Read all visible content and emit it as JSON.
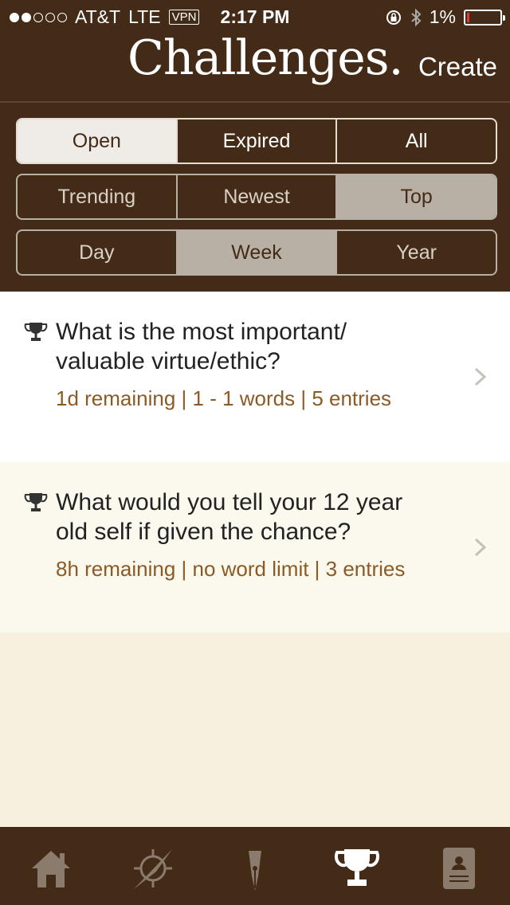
{
  "status_bar": {
    "carrier": "AT&T",
    "network": "LTE",
    "vpn": "VPN",
    "time": "2:17 PM",
    "battery": "1%"
  },
  "header": {
    "title": "Challenges.",
    "create_label": "Create"
  },
  "filters": {
    "status": [
      "Open",
      "Expired",
      "All"
    ],
    "status_selected": "Open",
    "sort": [
      "Trending",
      "Newest",
      "Top"
    ],
    "sort_selected": "Top",
    "period": [
      "Day",
      "Week",
      "Year"
    ],
    "period_selected": "Week"
  },
  "challenges": [
    {
      "question": "What is the most important/ valuable virtue/ethic?",
      "meta": "1d remaining  |  1 - 1 words  |  5 entries"
    },
    {
      "question": "What would you tell your 12 year old self if given the chance?",
      "meta": "8h remaining  |  no word limit  |  3 entries"
    }
  ],
  "tab_bar": {
    "icons": [
      "home-icon",
      "compass-icon",
      "pen-icon",
      "trophy-icon",
      "profile-icon"
    ],
    "active": "trophy-icon"
  },
  "colors": {
    "header_bg": "#432b17",
    "meta_text": "#8c5a24",
    "page_bg": "#f6f0de"
  }
}
